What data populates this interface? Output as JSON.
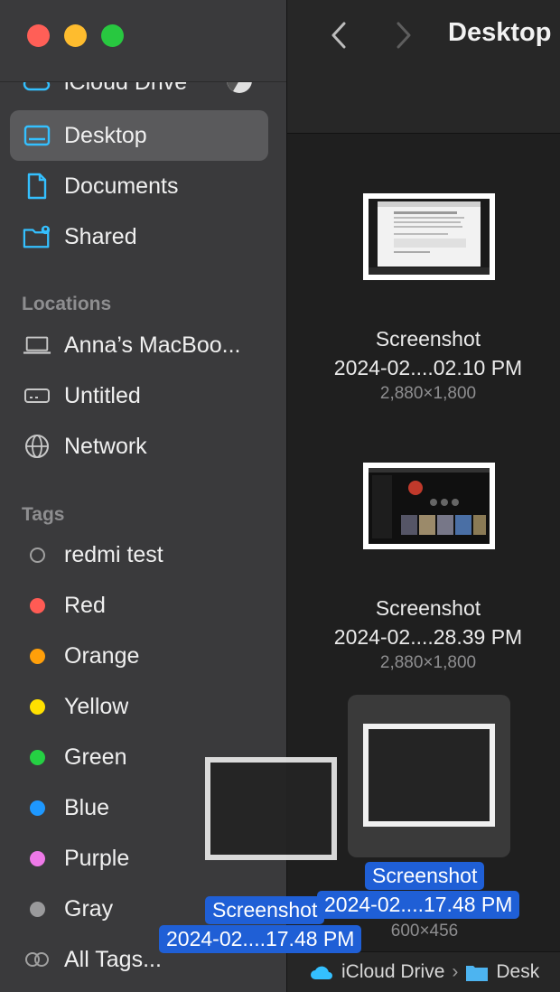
{
  "sidebar": {
    "partial_item": {
      "label": "iCloud Drive",
      "icon": "icloud-icon"
    },
    "favorites": [
      {
        "label": "Desktop",
        "icon": "desktop-icon",
        "selected": true
      },
      {
        "label": "Documents",
        "icon": "document-icon"
      },
      {
        "label": "Shared",
        "icon": "shared-folder-icon"
      }
    ],
    "locations_header": "Locations",
    "locations": [
      {
        "label": "Anna’s MacBoo...",
        "icon": "laptop-icon"
      },
      {
        "label": "Untitled",
        "icon": "drive-icon"
      },
      {
        "label": "Network",
        "icon": "globe-icon"
      }
    ],
    "tags_header": "Tags",
    "tags": [
      {
        "label": "redmi test",
        "color": "none"
      },
      {
        "label": "Red",
        "color": "#ff5b54"
      },
      {
        "label": "Orange",
        "color": "#ff9f0a"
      },
      {
        "label": "Yellow",
        "color": "#ffe000"
      },
      {
        "label": "Green",
        "color": "#25d043"
      },
      {
        "label": "Blue",
        "color": "#1e98ff"
      },
      {
        "label": "Purple",
        "color": "#ee79e8"
      },
      {
        "label": "Gray",
        "color": "#9a9a9c"
      }
    ],
    "all_tags": "All Tags..."
  },
  "toolbar": {
    "title": "Desktop"
  },
  "files": [
    {
      "name_line1": "Screenshot",
      "name_line2": "2024-02....02.10 PM",
      "meta": "2,880×1,800"
    },
    {
      "name_line1": "Screenshot",
      "name_line2": "2024-02....28.39 PM",
      "meta": "2,880×1,800"
    },
    {
      "name_line1": "Screenshot",
      "name_line2": "2024-02....17.48 PM",
      "meta": "600×456",
      "selected": true
    }
  ],
  "drag_ghost": {
    "line1": "Screenshot",
    "line2": "2024-02....17.48 PM"
  },
  "pathbar": {
    "items": [
      "iCloud Drive",
      "Desk"
    ]
  }
}
